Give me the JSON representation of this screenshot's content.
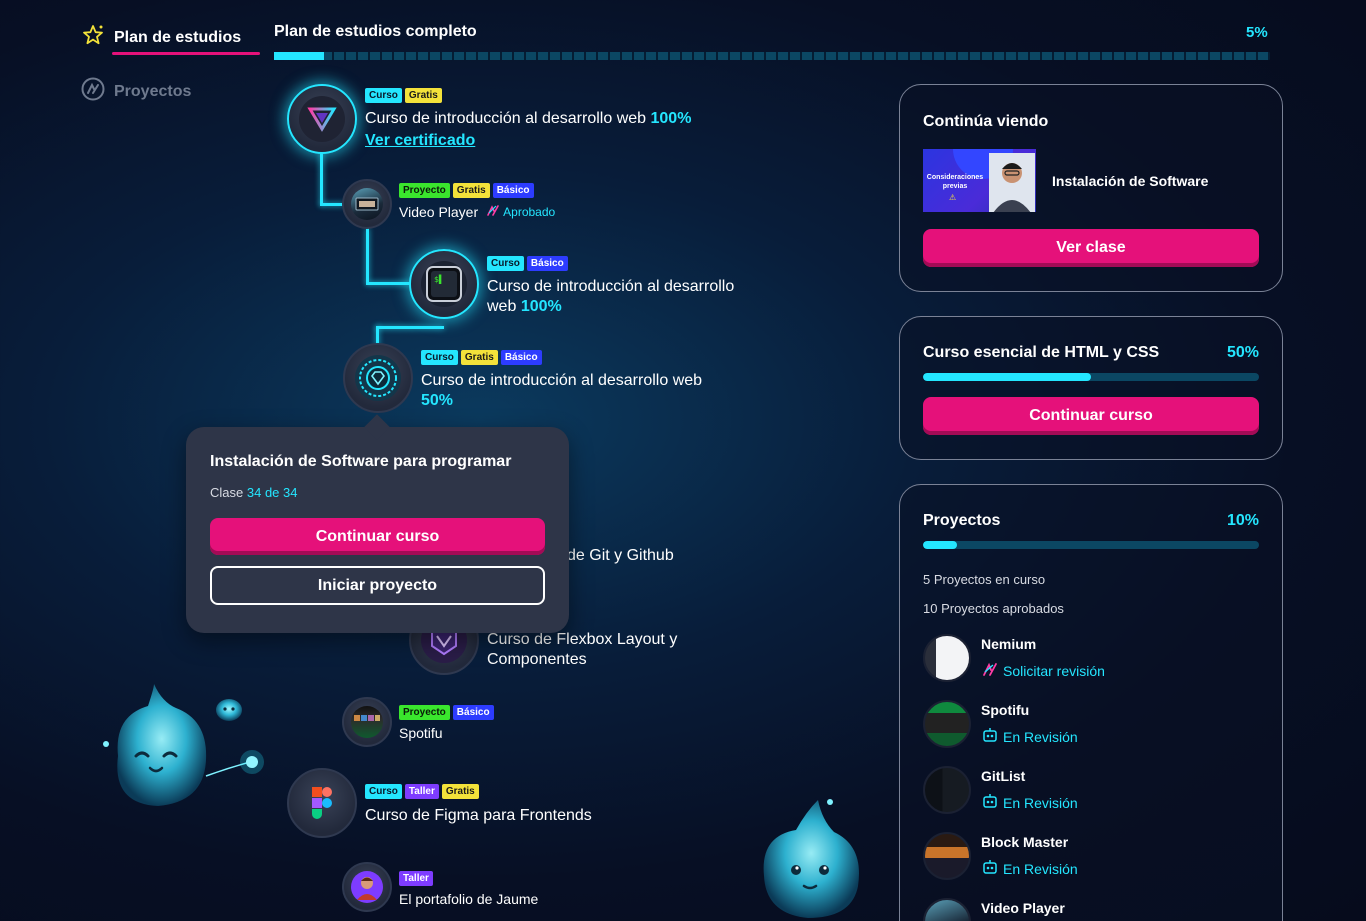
{
  "nav": {
    "plan_label": "Plan de estudios",
    "projects_label": "Proyectos"
  },
  "progress": {
    "title": "Plan de estudios completo",
    "percent_label": "5%",
    "percent": 0.05
  },
  "path": [
    {
      "tags": [
        "Curso",
        "Gratis"
      ],
      "title": "Curso de introducción al desarrollo web",
      "pct": "100%",
      "link": "Ver certificado",
      "icon": "triangle-logo-icon"
    },
    {
      "tags": [
        "Proyecto",
        "Gratis",
        "Básico"
      ],
      "title": "Video Player",
      "status": "Aprobado",
      "icon": "video-player-thumbnail"
    },
    {
      "tags": [
        "Curso",
        "Básico"
      ],
      "title": "Curso de introducción al desarrollo",
      "title2": "web",
      "pct": "100%",
      "icon": "terminal-icon"
    },
    {
      "tags": [
        "Curso",
        "Gratis",
        "Básico"
      ],
      "title": "Curso de introducción al desarrollo web",
      "pct": "50%",
      "icon": "gear-badge-icon"
    },
    {
      "title_partial": "de Git y Github"
    },
    {
      "title": "Curso de Flexbox Layout y",
      "title2": "Componentes",
      "icon": "flexbox-badge-icon"
    },
    {
      "tags": [
        "Proyecto",
        "Básico"
      ],
      "title": "Spotifu",
      "icon": "spotifu-thumbnail"
    },
    {
      "tags": [
        "Curso",
        "Taller",
        "Gratis"
      ],
      "title": "Curso de Figma para Frontends",
      "icon": "figma-icon"
    },
    {
      "tags": [
        "Taller"
      ],
      "title": "El portafolio de Jaume",
      "icon": "avatar"
    }
  ],
  "popover": {
    "title": "Instalación de Software para programar",
    "class_prefix": "Clase",
    "class_count": "34 de 34",
    "primary": "Continuar curso",
    "secondary": "Iniciar proyecto"
  },
  "continue_card": {
    "title": "Continúa viendo",
    "video_title": "Instalación de Software",
    "thumb_text": "Consideraciones previas",
    "button": "Ver clase"
  },
  "course_card": {
    "title": "Curso esencial de HTML y CSS",
    "percent_label": "50%",
    "percent": 0.5,
    "button": "Continuar curso"
  },
  "projects_card": {
    "title": "Proyectos",
    "percent_label": "10%",
    "percent": 0.1,
    "in_progress": "5 Proyectos en curso",
    "approved": "10 Proyectos aprobados",
    "items": [
      {
        "name": "Nemium",
        "status": "Solicitar revisión",
        "icon": "rocket-icon"
      },
      {
        "name": "Spotifu",
        "status": "En Revisión",
        "icon": "robot-icon"
      },
      {
        "name": "GitList",
        "status": "En Revisión",
        "icon": "robot-icon"
      },
      {
        "name": "Block Master",
        "status": "En Revisión",
        "icon": "robot-icon"
      },
      {
        "name": "Video Player",
        "status": "",
        "icon": ""
      }
    ]
  },
  "colors": {
    "accent": "#24e6ff",
    "pink": "#e5117a",
    "tag_curso": "#24e6ff",
    "tag_gratis": "#f3e23a",
    "tag_basico": "#2d3cff",
    "tag_proyecto": "#3ae62d",
    "tag_taller": "#7e3cff"
  }
}
